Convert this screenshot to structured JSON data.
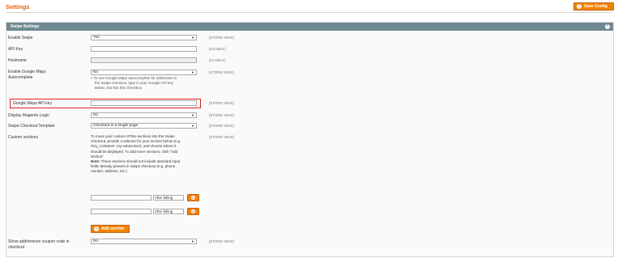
{
  "page": {
    "title": "Settings",
    "save_label": "Save Config"
  },
  "section": {
    "title": "Swipe Settings"
  },
  "rows": {
    "enable_swipe": {
      "label": "Enable Swipe",
      "value": "Yes",
      "scope": "[STORE VIEW]"
    },
    "api_key": {
      "label": "API Key",
      "value": "",
      "scope": "[GLOBAL]"
    },
    "hostname": {
      "label": "Hostname",
      "value": "",
      "scope": "[GLOBAL]"
    },
    "google_maps_autocomplete": {
      "label_line1": "Enable Google Maps",
      "label_line2": "Autocomplete",
      "value": "No",
      "scope": "[STORE VIEW]",
      "note_line1": "» To use Google Maps autocomplete for addresses in",
      "note_line2": "the Swipe checkout, type in your Google API key",
      "note_line3": "below, and tick this checkbox"
    },
    "google_maps_api_key": {
      "label": "Google Maps API key",
      "value": "",
      "scope": "[STORE VIEW]"
    },
    "display_magento_login": {
      "label": "Display Magento Login",
      "value": "No",
      "scope": "[STORE VIEW]"
    },
    "swipe_checkout_template": {
      "label": "Swipe Checkout Template",
      "value": "Checkout in a single page",
      "scope": "[STORE VIEW]"
    },
    "custom_sections": {
      "label": "Custom sections",
      "scope": "[STORE VIEW]",
      "desc_line1": "To move your custom HTML-sections into the Swipe",
      "desc_line2": "checkout, provide a selector for your section below (e.g.",
      "desc_line3": "#my_container .my-subsection), and choose where it",
      "desc_line4": "should be displayed. To add more sections, click \"Add",
      "desc_line5": "section\"",
      "note_bold": "Note:",
      "note_line1": " These sections should not include standard input",
      "note_line2": "fields already present in Swipe checkout (e.g. phone",
      "note_line3": "number, address, etc.)",
      "entries": [
        {
          "selector": "",
          "position": "After billing"
        },
        {
          "selector": "",
          "position": "After billing"
        }
      ],
      "add_label": "Add section"
    },
    "coupon_code": {
      "label_line1": "Show add/remove coupon code in",
      "label_line2": "checkout",
      "value": "No",
      "scope": "[STORE VIEW]"
    }
  },
  "icons": {
    "save": "check-icon",
    "collapse": "collapse-icon",
    "delete": "delete-icon",
    "add": "plus-icon"
  },
  "colors": {
    "accent": "#f18200",
    "section_header": "#6f8992",
    "highlight": "#e02020"
  }
}
